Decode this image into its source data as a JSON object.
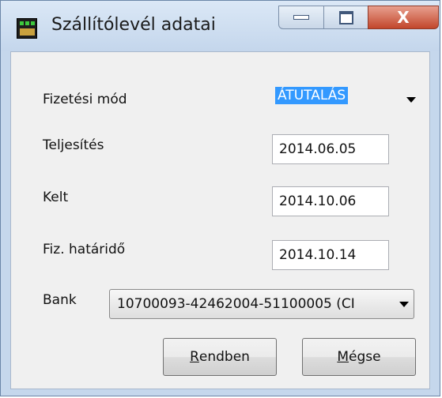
{
  "window": {
    "title": "Szállítólevél adatai",
    "close_glyph": "X"
  },
  "form": {
    "payment_label": "Fizetési mód",
    "payment_value": "ÁTUTALÁS",
    "completion_label": "Teljesítés",
    "completion_value": "2014.06.05",
    "issued_label": "Kelt",
    "issued_value": "2014.10.06",
    "due_label": "Fiz. határidő",
    "due_value": "2014.10.14",
    "bank_label": "Bank",
    "bank_value": "10700093-42462004-51100005 (CI"
  },
  "buttons": {
    "ok_first": "R",
    "ok_rest": "endben",
    "cancel_first": "M",
    "cancel_rest": "égse"
  },
  "colors": {
    "selection": "#3399ff",
    "close_button": "#c2462b",
    "titlebar": "#c4d6ec"
  }
}
